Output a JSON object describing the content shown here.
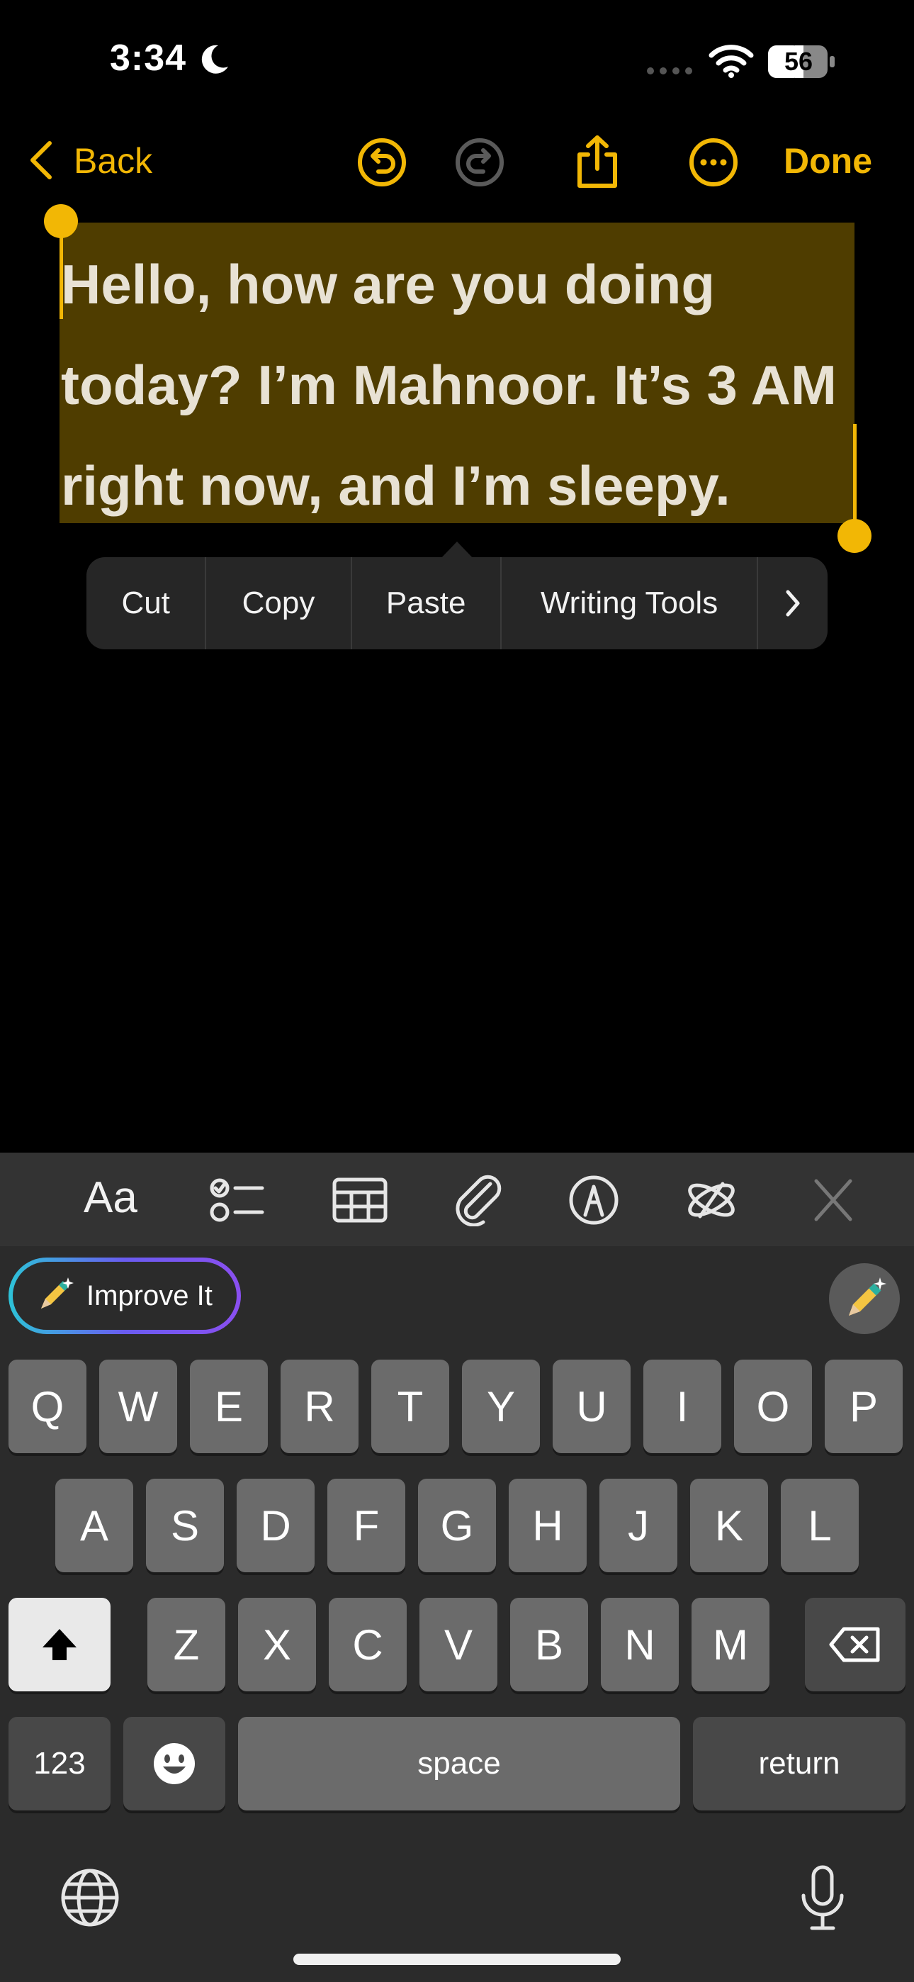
{
  "status_bar": {
    "time": "3:34",
    "battery": "56"
  },
  "nav": {
    "back_label": "Back",
    "done_label": "Done"
  },
  "note": {
    "text": "Hello, how are you doing today? I’m Mahnoor. It’s 3 AM right now, and I’m sleepy."
  },
  "context_menu": {
    "items": [
      "Cut",
      "Copy",
      "Paste",
      "Writing Tools"
    ]
  },
  "toolbar": {
    "format_label": "Aa"
  },
  "suggestion": {
    "label": "Improve It"
  },
  "keyboard": {
    "row1": [
      "Q",
      "W",
      "E",
      "R",
      "T",
      "Y",
      "U",
      "I",
      "O",
      "P"
    ],
    "row2": [
      "A",
      "S",
      "D",
      "F",
      "G",
      "H",
      "J",
      "K",
      "L"
    ],
    "row3": [
      "Z",
      "X",
      "C",
      "V",
      "B",
      "N",
      "M"
    ],
    "numbers_label": "123",
    "space_label": "space",
    "return_label": "return"
  },
  "colors": {
    "accent": "#f2b705",
    "selection": "#4f3d00"
  }
}
